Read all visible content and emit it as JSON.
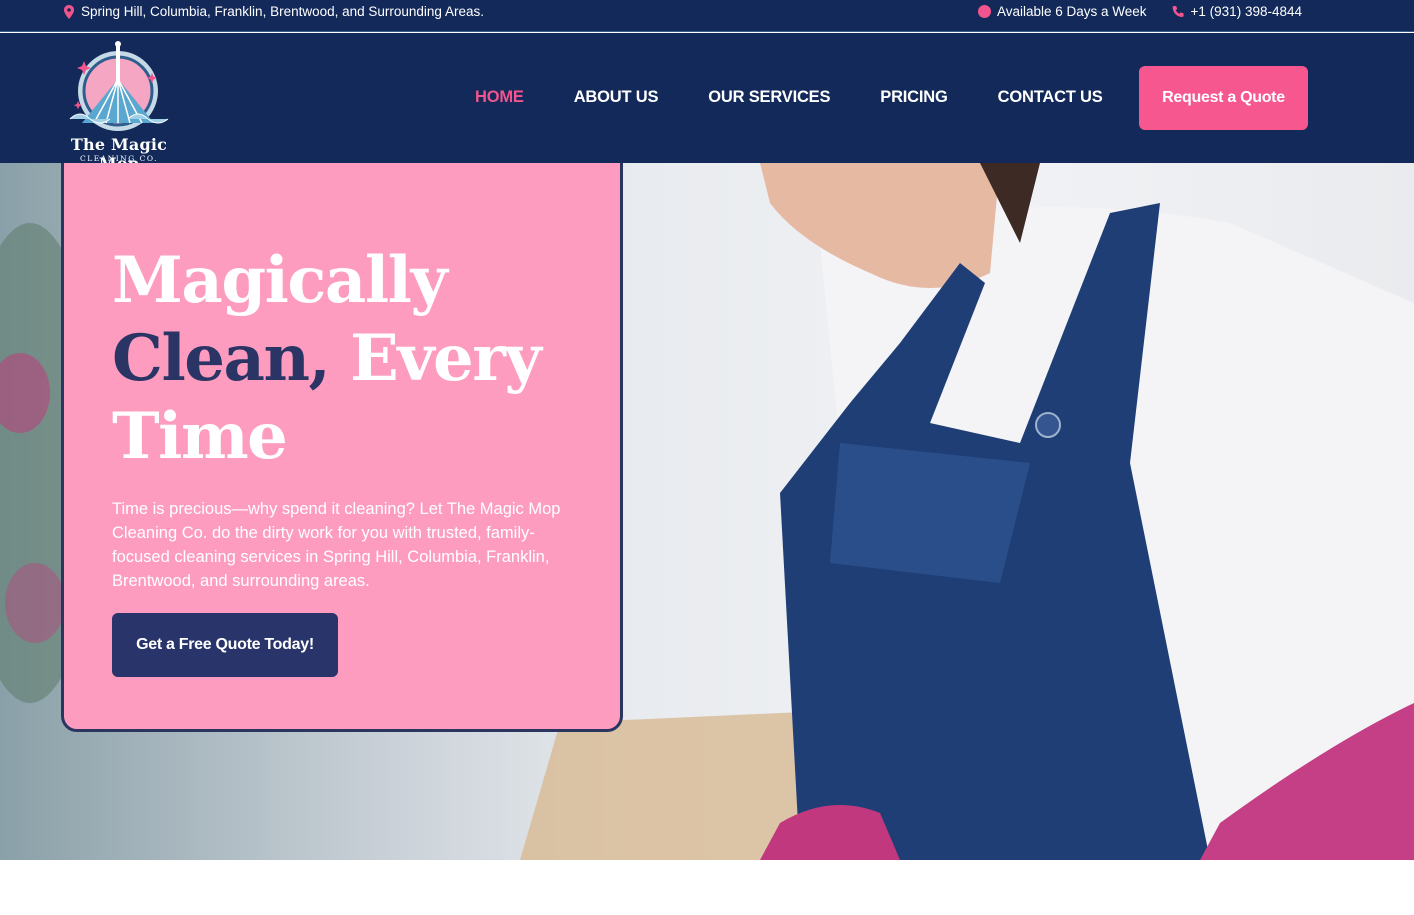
{
  "topbar": {
    "location": "Spring Hill, Columbia, Franklin, Brentwood, and Surrounding Areas.",
    "availability": "Available 6 Days a Week",
    "phone": "+1 (931) 398-4844"
  },
  "brand": {
    "name_line1": "The Magic Mop",
    "name_line2": "CLEANING CO."
  },
  "nav": {
    "items": [
      {
        "label": "HOME",
        "active": true
      },
      {
        "label": "ABOUT US",
        "active": false
      },
      {
        "label": "OUR SERVICES",
        "active": false
      },
      {
        "label": "PRICING",
        "active": false
      },
      {
        "label": "CONTACT US",
        "active": false
      }
    ],
    "cta": "Request a Quote"
  },
  "hero": {
    "headline_part1": "Magically",
    "headline_accent": "Clean,",
    "headline_part2": "Every Time",
    "text": "Time is precious—why spend it cleaning? Let The Magic Mop Cleaning Co. do the dirty work for you with trusted, family-focused cleaning services in Spring Hill, Columbia, Franklin, Brentwood, and surrounding areas.",
    "button": "Get a Free Quote Today!"
  },
  "colors": {
    "navy": "#12295a",
    "pink": "#f7578f",
    "card_pink": "#fd9cbf",
    "button_navy": "#28346a"
  },
  "icons": [
    "map-pin-icon",
    "clock-icon",
    "phone-icon",
    "magic-mop-logo"
  ]
}
